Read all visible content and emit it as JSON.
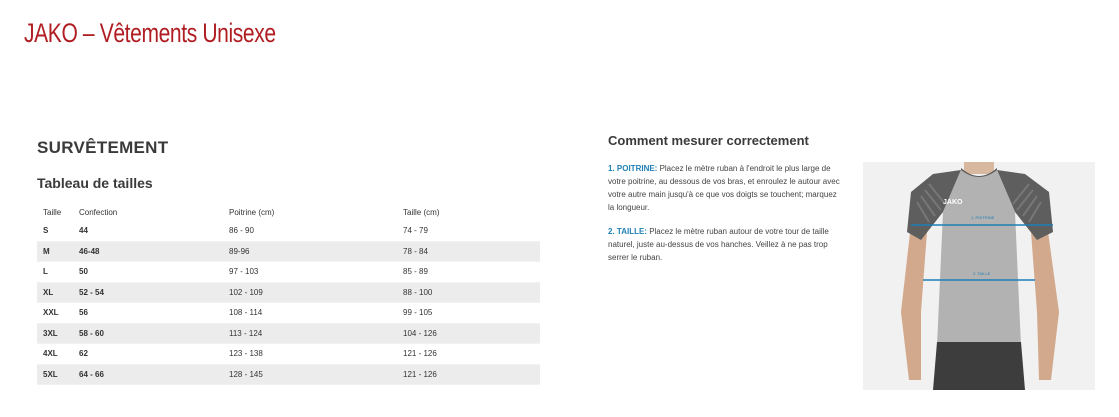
{
  "page": {
    "title": "JAKO – Vêtements Unisexe"
  },
  "section": {
    "title": "SURVÊTEMENT",
    "table_title": "Tableau de tailles"
  },
  "table": {
    "headers": [
      "Taille",
      "Confection",
      "Poitrine (cm)",
      "Taille (cm)"
    ],
    "rows": [
      [
        "S",
        "44",
        "86 - 90",
        "74 - 79"
      ],
      [
        "M",
        "46-48",
        "89-96",
        "78 - 84"
      ],
      [
        "L",
        "50",
        "97 - 103",
        "85 - 89"
      ],
      [
        "XL",
        "52 - 54",
        "102 - 109",
        "88 - 100"
      ],
      [
        "XXL",
        "56",
        "108 - 114",
        "99 - 105"
      ],
      [
        "3XL",
        "58 - 60",
        "113 - 124",
        "104 - 126"
      ],
      [
        "4XL",
        "62",
        "123 - 138",
        "121 - 126"
      ],
      [
        "5XL",
        "64 - 66",
        "128 - 145",
        "121 - 126"
      ]
    ]
  },
  "measure": {
    "title": "Comment mesurer correctement",
    "item1_label": "1. POITRINE:",
    "item1_text": " Placez le mètre ruban à l'endroit le plus large de votre poitrine, au dessous de vos bras, et enroulez le autour avec votre autre main jusqu'à ce que vos doigts se touchent; marquez la longueur.",
    "item2_label": "2. TAILLE:",
    "item2_text": " Placez le mètre ruban autour de votre tour de taille naturel, juste au-dessus de vos hanches. Veillez à ne pas trop serrer le ruban."
  },
  "photo": {
    "logo": "JAKO",
    "line1_label": "1. POITRINE",
    "line2_label": "2. TAILLE",
    "line_color": "#1f7fb5"
  }
}
